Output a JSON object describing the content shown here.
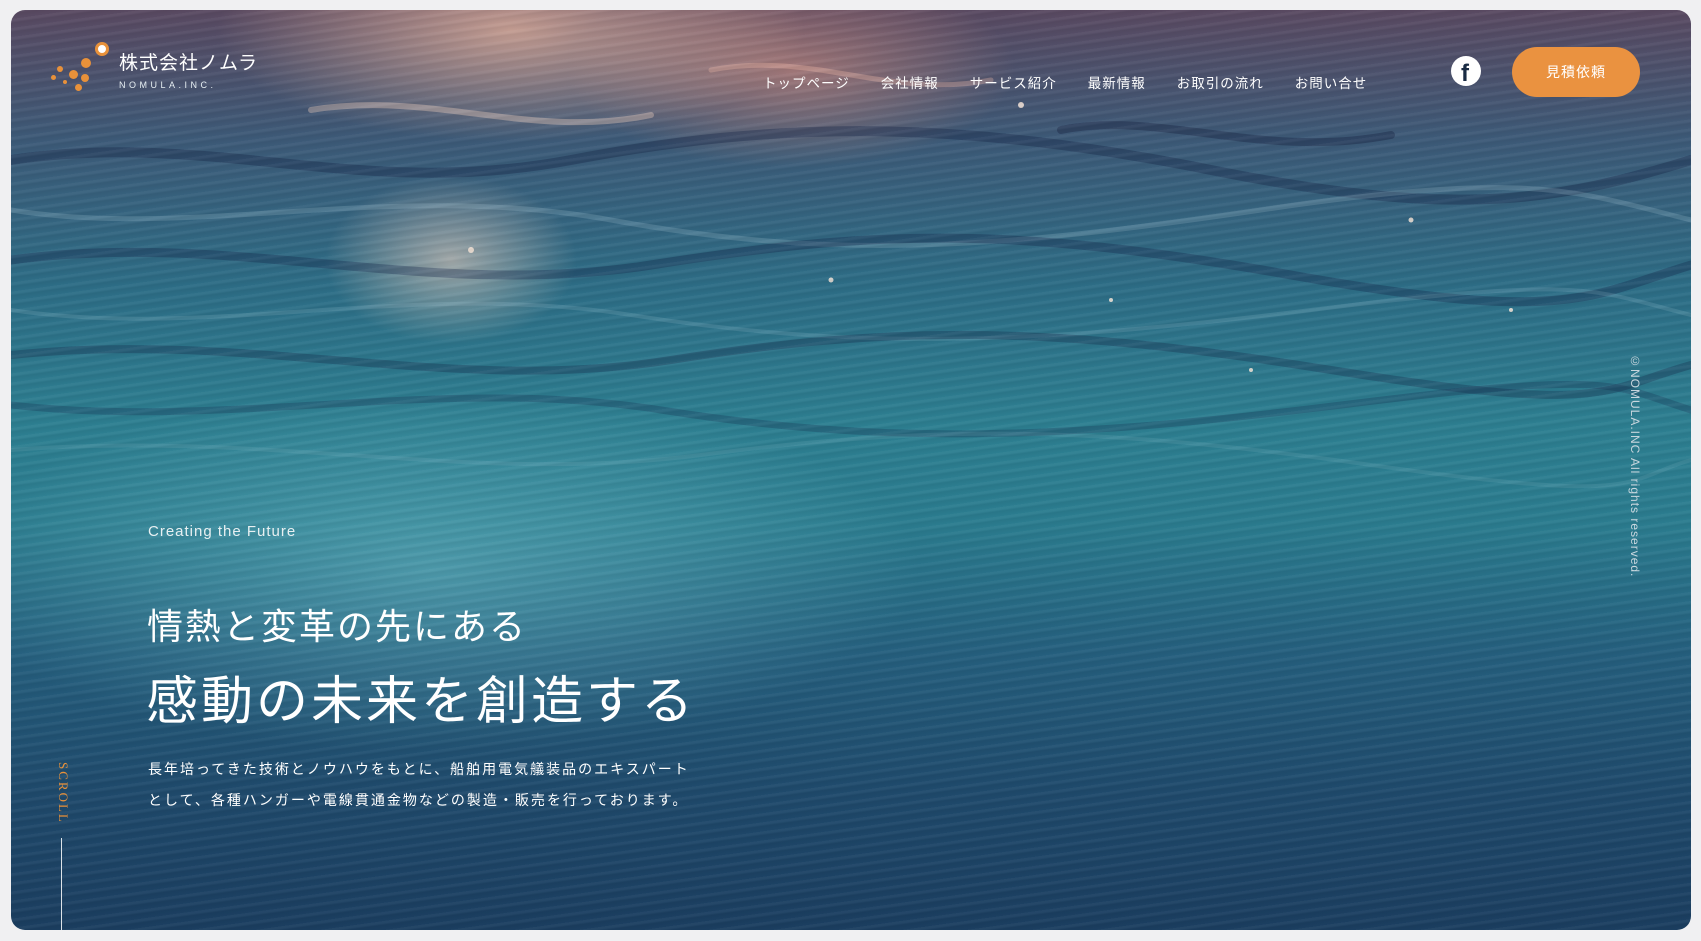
{
  "brand": {
    "name": "株式会社ノムラ",
    "sub": "NOMULA.INC."
  },
  "nav": {
    "items": [
      {
        "label": "トップページ"
      },
      {
        "label": "会社情報"
      },
      {
        "label": "サービス紹介"
      },
      {
        "label": "最新情報"
      },
      {
        "label": "お取引の流れ"
      },
      {
        "label": "お問い合せ"
      }
    ],
    "facebook_icon": "facebook-icon",
    "quote_button": "見積依頼"
  },
  "hero": {
    "tagline": "Creating the Future",
    "headline_1": "情熱と変革の先にある",
    "headline_2": "感動の未来を創造する",
    "desc_line_1": "長年培ってきた技術とノウハウをもとに、船舶用電気艤装品のエキスパート",
    "desc_line_2": "として、各種ハンガーや電線貫通金物などの製造・販売を行っております。"
  },
  "side": {
    "copyright": "©NOMULA.INC All rights reserved.",
    "scroll": "SCROLL"
  },
  "colors": {
    "accent": "#ea9240",
    "text": "#ffffff",
    "water_dark": "#1b3e60",
    "water_mid": "#2d7f91"
  }
}
